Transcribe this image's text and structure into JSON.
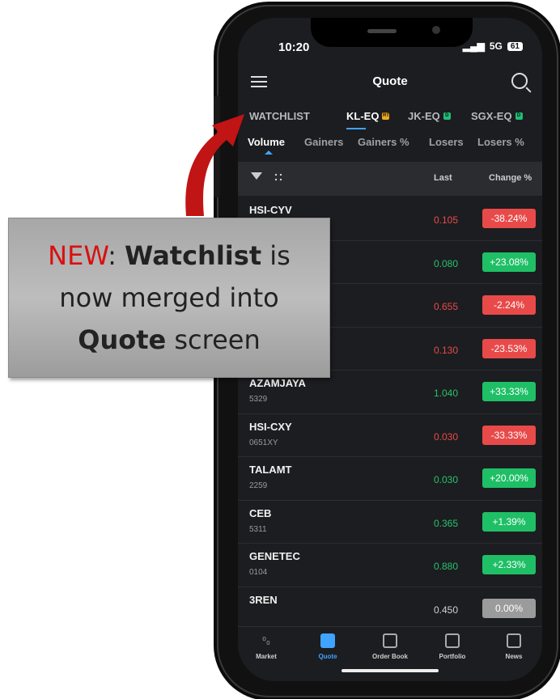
{
  "status": {
    "time": "10:20",
    "signal": "5G",
    "battery": "61"
  },
  "header": {
    "title": "Quote"
  },
  "markets": [
    {
      "label": "WATCHLIST",
      "badge": "",
      "badge_color": ""
    },
    {
      "label": "KL-EQ",
      "badge": "RT",
      "badge_color": "#f2a81d"
    },
    {
      "label": "JK-EQ",
      "badge": "D",
      "badge_color": "#1fbf75"
    },
    {
      "label": "SGX-EQ",
      "badge": "D",
      "badge_color": "#1fbf75"
    }
  ],
  "sort_tabs": [
    "Volume",
    "Gainers",
    "Gainers %",
    "Losers",
    "Losers %"
  ],
  "table": {
    "col_last": "Last",
    "col_change": "Change %"
  },
  "rows": [
    {
      "symbol": "HSI-CYV",
      "code": "",
      "last": "0.105",
      "change": "-38.24%",
      "dir": "down"
    },
    {
      "symbol": "",
      "code": "",
      "last": "0.080",
      "change": "+23.08%",
      "dir": "up"
    },
    {
      "symbol": "",
      "code": "",
      "last": "0.655",
      "change": "-2.24%",
      "dir": "down"
    },
    {
      "symbol": "",
      "code": "",
      "last": "0.130",
      "change": "-23.53%",
      "dir": "down"
    },
    {
      "symbol": "AZAMJAYA",
      "code": "5329",
      "last": "1.040",
      "change": "+33.33%",
      "dir": "up"
    },
    {
      "symbol": "HSI-CXY",
      "code": "0651XY",
      "last": "0.030",
      "change": "-33.33%",
      "dir": "down"
    },
    {
      "symbol": "TALAMT",
      "code": "2259",
      "last": "0.030",
      "change": "+20.00%",
      "dir": "up"
    },
    {
      "symbol": "CEB",
      "code": "5311",
      "last": "0.365",
      "change": "+1.39%",
      "dir": "up"
    },
    {
      "symbol": "GENETEC",
      "code": "0104",
      "last": "0.880",
      "change": "+2.33%",
      "dir": "up"
    },
    {
      "symbol": "3REN",
      "code": "",
      "last": "0.450",
      "change": "0.00%",
      "dir": "flat"
    }
  ],
  "colors": {
    "up": "#1fbf66",
    "down": "#e84a4a",
    "flat": "#9b9b9b",
    "up_text": "#27c26c",
    "down_text": "#e54b4b",
    "flat_text": "#d0d0d0",
    "accent": "#3fa3ff"
  },
  "nav": [
    {
      "label": "Market",
      "icon": "market-icon"
    },
    {
      "label": "Quote",
      "icon": "chart-icon"
    },
    {
      "label": "Order Book",
      "icon": "cart-icon"
    },
    {
      "label": "Portfolio",
      "icon": "briefcase-icon"
    },
    {
      "label": "News",
      "icon": "news-icon"
    }
  ],
  "callout": {
    "new": "NEW",
    "colon": ":",
    "watchlist": "Watchlist",
    "text1": " is",
    "line2": "now merged into",
    "quote": "Quote",
    "text3": " screen"
  }
}
